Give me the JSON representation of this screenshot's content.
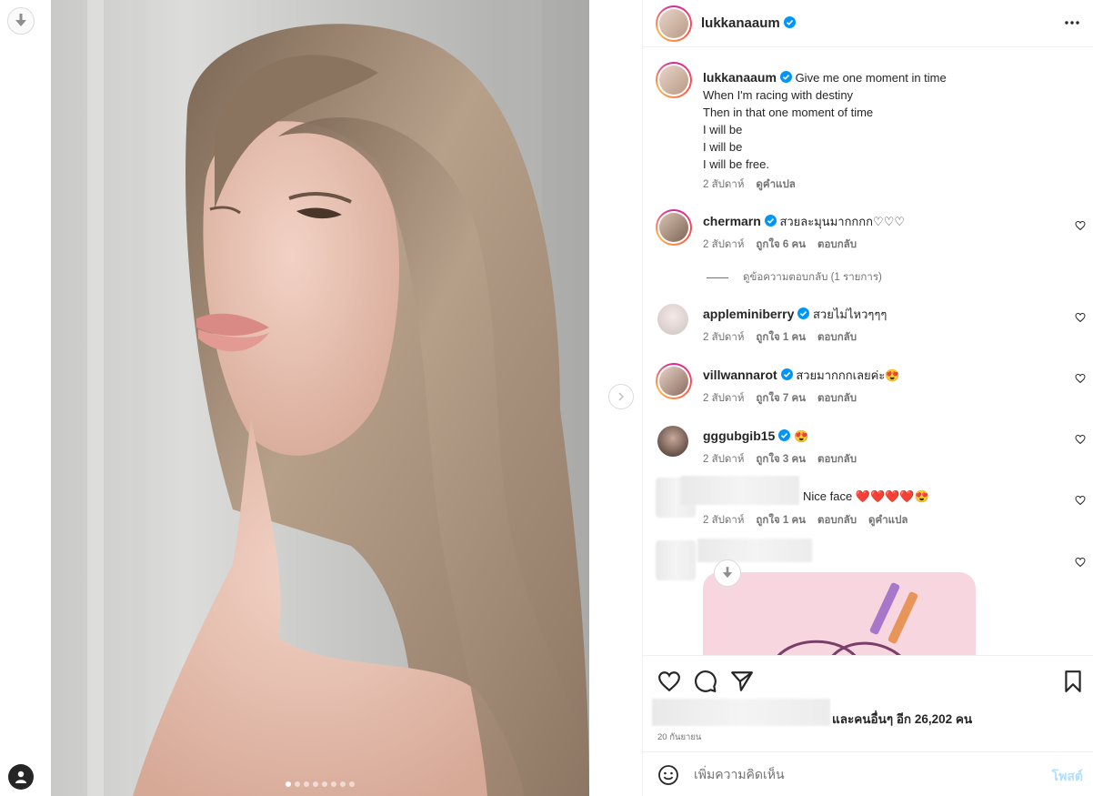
{
  "post": {
    "username": "lukkanaaum",
    "caption_lines": [
      "Give me one moment in time",
      "When I'm racing with destiny",
      "Then in that one moment of time",
      "I will be",
      "I will be",
      "I will be free."
    ],
    "caption_time": "2 สัปดาห์",
    "caption_translate": "ดูคำแปล",
    "carousel": {
      "slides": 8,
      "active": 1
    }
  },
  "comments": [
    {
      "username": "chermarn",
      "verified": true,
      "text": "สวยละมุนมากกกก♡♡♡",
      "time": "2 สัปดาห์",
      "likes": "ถูกใจ 6 คน",
      "reply": "ตอบกลับ"
    },
    {
      "username": "appleminiberry",
      "verified": true,
      "text": "สวยไม่ไหวๆๆๆ",
      "time": "2 สัปดาห์",
      "likes": "ถูกใจ 1 คน",
      "reply": "ตอบกลับ"
    },
    {
      "username": "villwannarot",
      "verified": true,
      "text": "สวยมากกกเลยค่ะ😍",
      "time": "2 สัปดาห์",
      "likes": "ถูกใจ 7 คน",
      "reply": "ตอบกลับ"
    },
    {
      "username": "gggubgib15",
      "verified": true,
      "text": "😍",
      "time": "2 สัปดาห์",
      "likes": "ถูกใจ 3 คน",
      "reply": "ตอบกลับ"
    },
    {
      "username": "",
      "verified": false,
      "text": "Nice face ❤️❤️❤️❤️😍",
      "time": "2 สัปดาห์",
      "likes": "ถูกใจ 1 คน",
      "reply": "ตอบกลับ",
      "translate": "ดูคำแปล"
    }
  ],
  "view_replies": "ดูข้อความตอบกลับ (1 รายการ)",
  "likes_summary": "และคนอื่นๆ อีก 26,202 คน",
  "post_date": "20 กันยายน",
  "add_comment": {
    "placeholder": "เพิ่มความคิดเห็น",
    "post_label": "โพสต์"
  },
  "colors": {
    "verified": "#0095f6",
    "secondary_text": "#737373",
    "post_disabled": "#b2dffc"
  },
  "icons": [
    "download-icon",
    "chevron-right-icon",
    "more-icon",
    "verified-icon",
    "heart-icon",
    "comment-icon",
    "share-icon",
    "bookmark-icon",
    "emoji-icon",
    "profile-icon"
  ]
}
